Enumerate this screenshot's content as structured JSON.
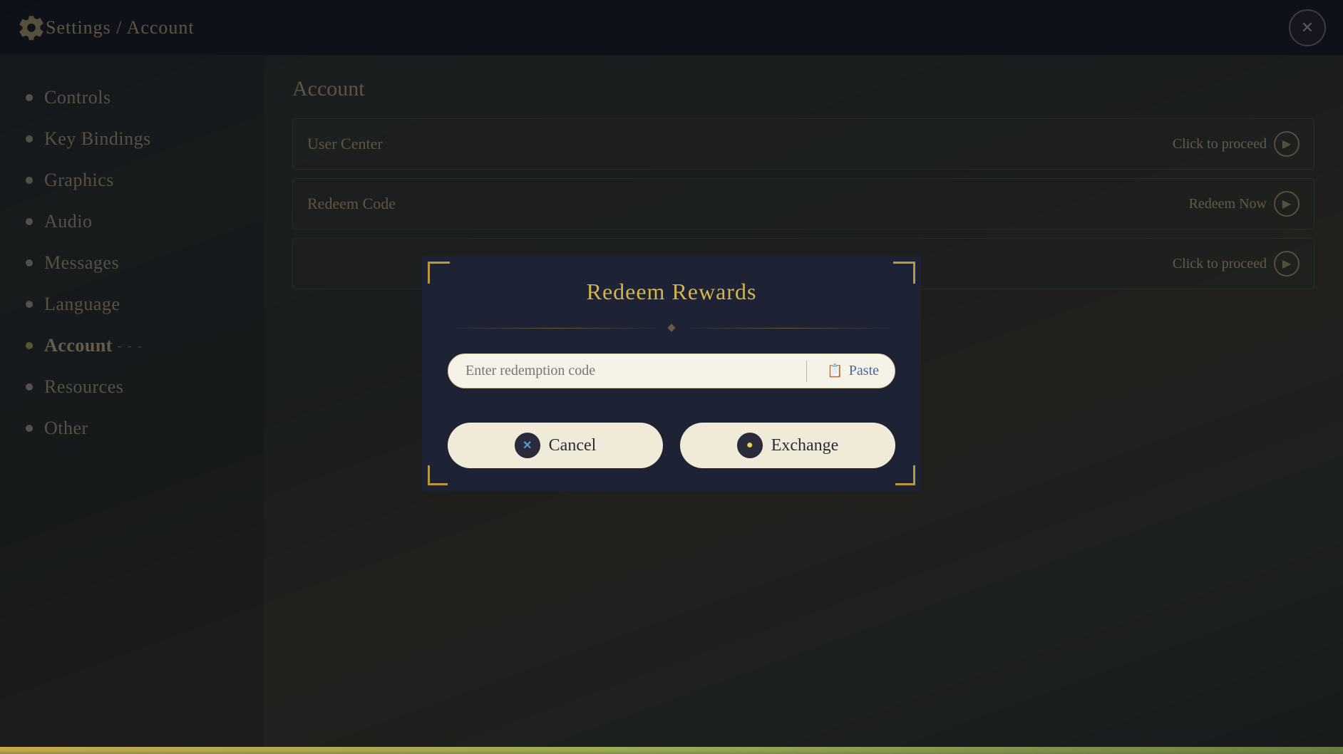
{
  "header": {
    "title": "Settings / Account",
    "close_label": "✕"
  },
  "sidebar": {
    "items": [
      {
        "id": "controls",
        "label": "Controls",
        "active": false
      },
      {
        "id": "key-bindings",
        "label": "Key Bindings",
        "active": false
      },
      {
        "id": "graphics",
        "label": "Graphics",
        "active": false
      },
      {
        "id": "audio",
        "label": "Audio",
        "active": false
      },
      {
        "id": "messages",
        "label": "Messages",
        "active": false
      },
      {
        "id": "language",
        "label": "Language",
        "active": false
      },
      {
        "id": "account",
        "label": "Account",
        "active": true
      },
      {
        "id": "resources",
        "label": "Resources",
        "active": false
      },
      {
        "id": "other",
        "label": "Other",
        "active": false
      }
    ]
  },
  "content": {
    "title": "Account",
    "rows": [
      {
        "id": "user-center",
        "label": "User Center",
        "action": "Click to proceed"
      },
      {
        "id": "redeem-code",
        "label": "Redeem Code",
        "action": "Redeem Now"
      },
      {
        "id": "row3",
        "label": "",
        "action": "Click to proceed"
      }
    ]
  },
  "modal": {
    "title": "Redeem Rewards",
    "input_placeholder": "Enter redemption code",
    "paste_label": "Paste",
    "cancel_label": "Cancel",
    "exchange_label": "Exchange"
  }
}
